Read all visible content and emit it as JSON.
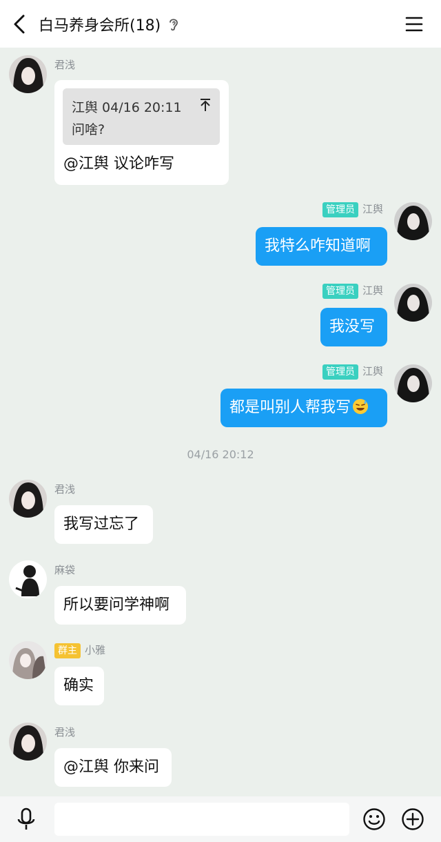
{
  "header": {
    "title": "白马养身会所(18)",
    "back_icon": "chevron-left-icon",
    "ear_icon": "ear-icon",
    "menu_icon": "hamburger-menu-icon"
  },
  "messages": [
    {
      "sender": "君浅",
      "direction": "incoming",
      "quote": {
        "author_time": "江舆 04/16 20:11",
        "text": "问啥?"
      },
      "text": "@江舆 议论咋写"
    },
    {
      "sender": "江舆",
      "badge": "管理员",
      "direction": "outgoing",
      "text": "我特么咋知道啊"
    },
    {
      "sender": "江舆",
      "badge": "管理员",
      "direction": "outgoing",
      "text": "我没写"
    },
    {
      "sender": "江舆",
      "badge": "管理员",
      "direction": "outgoing",
      "text": "都是叫别人帮我写",
      "emoji": "grinning-sweat-emoji"
    },
    {
      "sender": "君浅",
      "direction": "incoming",
      "text": "我写过忘了"
    },
    {
      "sender": "麻袋",
      "direction": "incoming",
      "text": "所以要问学神啊"
    },
    {
      "sender": "小雅",
      "badge": "群主",
      "direction": "incoming",
      "text": "确实"
    },
    {
      "sender": "君浅",
      "direction": "incoming",
      "text": "@江舆 你来问"
    }
  ],
  "timestamp": "04/16 20:12",
  "input": {
    "placeholder": "",
    "value": ""
  },
  "colors": {
    "background": "#ebf0ec",
    "outgoing_bubble": "#1a9ff5",
    "admin_badge": "#3ad0c0",
    "owner_badge": "#f5c232"
  }
}
